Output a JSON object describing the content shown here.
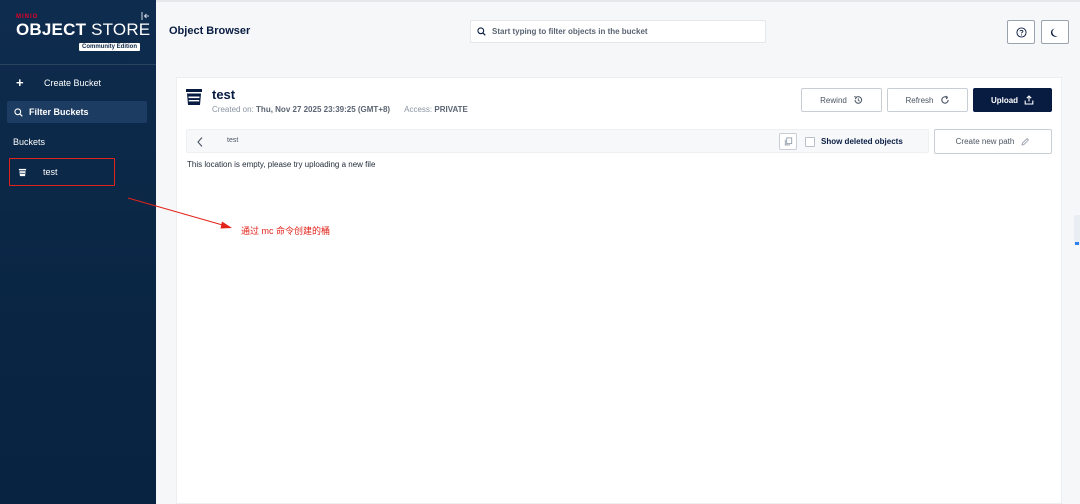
{
  "sidebar": {
    "logo_small": "MINIO",
    "logo_bold": "OBJECT",
    "logo_thin": " STORE",
    "edition": "Community Edition",
    "create_bucket": "Create Bucket",
    "filter_placeholder": "Filter Buckets",
    "buckets_label": "Buckets",
    "buckets": [
      {
        "name": "test"
      }
    ]
  },
  "header": {
    "title": "Object Browser",
    "search_placeholder": "Start typing to filter objects in the bucket"
  },
  "bucket": {
    "name": "test",
    "created_label": "Created on:",
    "created_value": "Thu, Nov 27 2025 23:39:25 (GMT+8)",
    "access_label": "Access:",
    "access_value": "PRIVATE"
  },
  "actions": {
    "rewind": "Rewind",
    "refresh": "Refresh",
    "upload": "Upload",
    "create_new_path": "Create new path"
  },
  "path_bar": {
    "path": "test",
    "show_deleted": "Show deleted objects"
  },
  "content": {
    "empty_message": "This location is empty, please try uploading a new file"
  },
  "annotation": {
    "text": "通过 mc 命令创建的桶",
    "color": "#e2231a"
  },
  "colors": {
    "sidebar_bg": "#0b2746",
    "primary": "#081c42",
    "accent_red": "#e2231a"
  }
}
